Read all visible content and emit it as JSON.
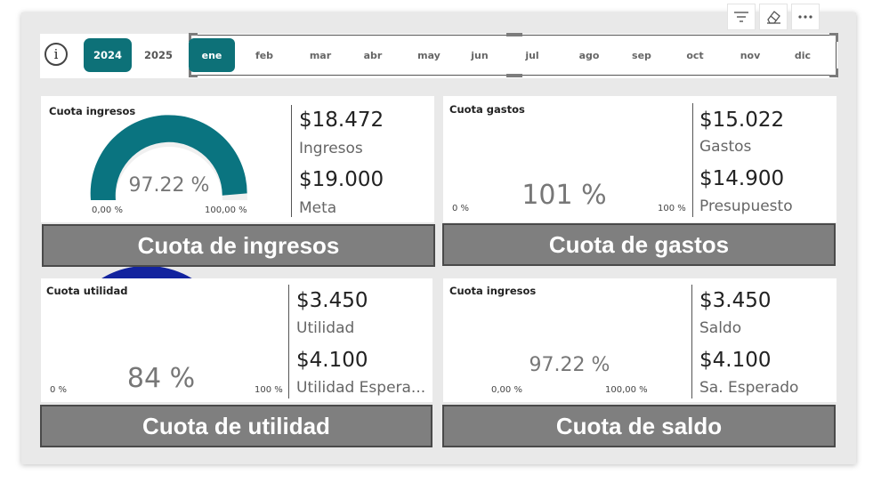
{
  "toolbar": {
    "filter_icon": "filter-lines-icon",
    "eraser_icon": "eraser-icon",
    "more_icon": "more-dots-icon"
  },
  "info_icon": {
    "glyph": "i"
  },
  "years": {
    "active": "2024",
    "other": "2025"
  },
  "months": [
    "ene",
    "feb",
    "mar",
    "abr",
    "may",
    "jun",
    "jul",
    "ago",
    "sep",
    "oct",
    "nov",
    "dic"
  ],
  "active_month": "ene",
  "cards": {
    "ingresos": {
      "title": "Cuota ingresos",
      "percent_text": "97.22 %",
      "min_label": "0,00 %",
      "max_label": "100,00 %",
      "value1": "$18.472",
      "label1": "Ingresos",
      "value2": "$19.000",
      "label2": "Meta",
      "banner": "Cuota de ingresos",
      "fraction": 0.9722,
      "color": "#0a7480"
    },
    "gastos": {
      "title": "Cuota gastos",
      "percent_text": "101 %",
      "min_label": "0 %",
      "max_label": "100 %",
      "value1": "$15.022",
      "label1": "Gastos",
      "value2": "$14.900",
      "label2": "Presupuesto",
      "banner": "Cuota de gastos",
      "fraction": 1.0,
      "color": "#e66c37"
    },
    "utilidad": {
      "title": "Cuota utilidad",
      "percent_text": "84 %",
      "min_label": "0 %",
      "max_label": "100 %",
      "value1": "$3.450",
      "label1": "Utilidad",
      "value2": "$4.100",
      "label2": "Utilidad Espera...",
      "banner": "Cuota de utilidad",
      "fraction": 0.84,
      "color": "#12239e"
    },
    "saldo": {
      "title": "Cuota ingresos",
      "percent_text": "97.22 %",
      "min_label": "0,00 %",
      "max_label": "100,00 %",
      "value1": "$3.450",
      "label1": "Saldo",
      "value2": "$4.100",
      "label2": "Sa. Esperado",
      "banner": "Cuota de saldo",
      "fraction": 0.9722,
      "color": "#6b007b"
    }
  }
}
